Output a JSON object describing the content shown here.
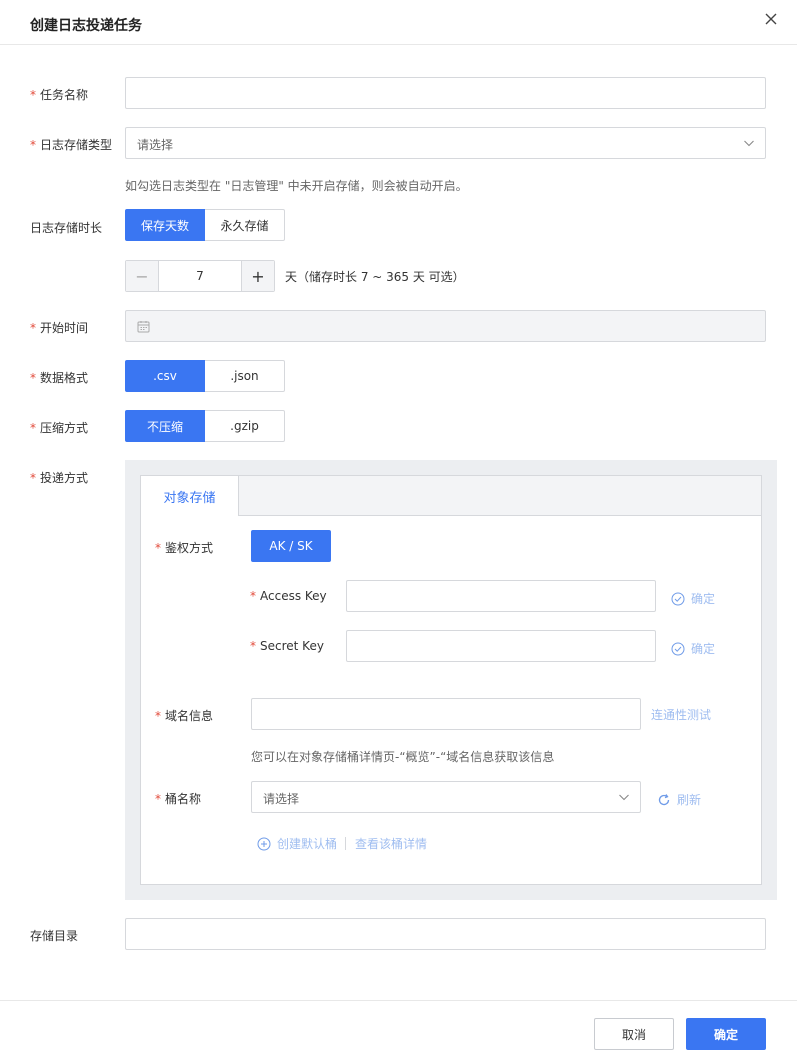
{
  "dialog": {
    "title": "创建日志投递任务"
  },
  "form": {
    "task_name": {
      "label": "任务名称",
      "value": ""
    },
    "log_type": {
      "label": "日志存储类型",
      "placeholder": "请选择",
      "hint": "如勾选日志类型在 \"日志管理\" 中未开启存储，则会被自动开启。"
    },
    "retention": {
      "label": "日志存储时长",
      "options": [
        "保存天数",
        "永久存储"
      ],
      "selected": "保存天数",
      "days": "7",
      "unit_hint": "天（储存时长 7 ~ 365 天 可选）"
    },
    "start_time": {
      "label": "开始时间",
      "value": ""
    },
    "data_format": {
      "label": "数据格式",
      "options": [
        ".csv",
        ".json"
      ],
      "selected": ".csv"
    },
    "compression": {
      "label": "压缩方式",
      "options": [
        "不压缩",
        ".gzip"
      ],
      "selected": "不压缩"
    },
    "delivery": {
      "label": "投递方式",
      "tab": "对象存储",
      "auth": {
        "label": "鉴权方式",
        "button": "AK / SK"
      },
      "access_key": {
        "label": "Access Key",
        "value": "",
        "confirm": "确定"
      },
      "secret_key": {
        "label": "Secret Key",
        "value": "",
        "confirm": "确定"
      },
      "domain": {
        "label": "域名信息",
        "value": "",
        "test": "连通性测试",
        "hint": "您可以在对象存储桶详情页-“概览”-“域名信息获取该信息"
      },
      "bucket": {
        "label": "桶名称",
        "placeholder": "请选择",
        "refresh": "刷新",
        "create": "创建默认桶",
        "view": "查看该桶详情"
      }
    },
    "directory": {
      "label": "存储目录",
      "value": ""
    }
  },
  "footer": {
    "cancel": "取消",
    "ok": "确定"
  },
  "colors": {
    "primary": "#3a76f2",
    "required": "#e24b3b",
    "link_disabled": "#9fbdf0"
  }
}
